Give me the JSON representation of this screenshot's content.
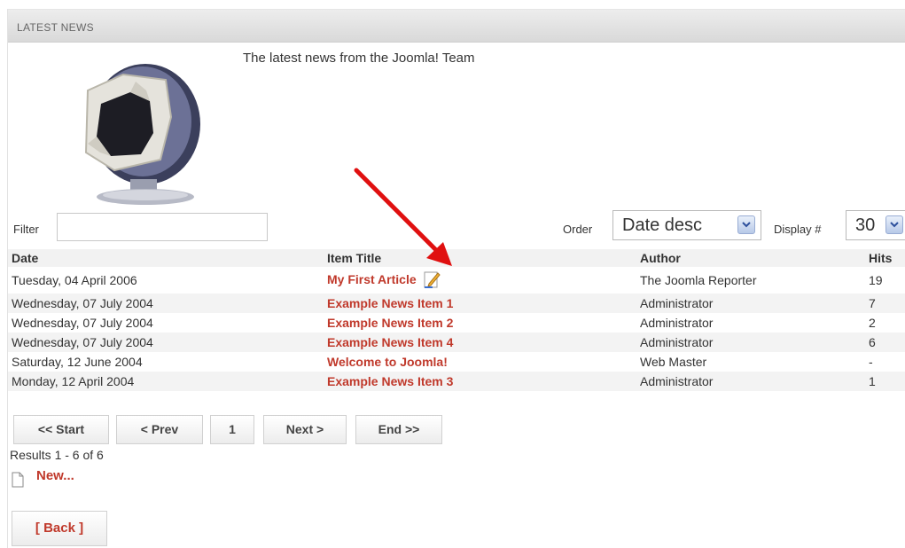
{
  "section": {
    "title": "LATEST NEWS"
  },
  "intro": {
    "text": "The latest news from the Joomla! Team"
  },
  "filter": {
    "label": "Filter",
    "value": ""
  },
  "order": {
    "label": "Order",
    "selected": "Date desc"
  },
  "display": {
    "label": "Display #",
    "selected": "30"
  },
  "table": {
    "headers": {
      "date": "Date",
      "title": "Item Title",
      "author": "Author",
      "hits": "Hits"
    },
    "rows": [
      {
        "date": "Tuesday, 04 April 2006",
        "title": "My First Article",
        "author": "The Joomla Reporter",
        "hits": "19"
      },
      {
        "date": "Wednesday, 07 July 2004",
        "title": "Example News Item 1",
        "author": "Administrator",
        "hits": "7"
      },
      {
        "date": "Wednesday, 07 July 2004",
        "title": "Example News Item 2",
        "author": "Administrator",
        "hits": "2"
      },
      {
        "date": "Wednesday, 07 July 2004",
        "title": "Example News Item 4",
        "author": "Administrator",
        "hits": "6"
      },
      {
        "date": "Saturday, 12 June 2004",
        "title": "Welcome to Joomla!",
        "author": "Web Master",
        "hits": "-"
      },
      {
        "date": "Monday, 12 April 2004",
        "title": "Example News Item 3",
        "author": "Administrator",
        "hits": "1"
      }
    ]
  },
  "pagination": {
    "start": "<< Start",
    "prev": "< Prev",
    "page": "1",
    "next": "Next >",
    "end": "End >>",
    "results": "Results 1 - 6 of 6"
  },
  "actions": {
    "new_label": "New...",
    "back_label": "[ Back ]"
  },
  "colors": {
    "link": "#c0392b",
    "annotation_arrow": "#e01010"
  },
  "icons": {
    "edit": "edit-pencil-icon",
    "new_doc": "document-icon",
    "dropdown": "chevron-down-icon"
  }
}
